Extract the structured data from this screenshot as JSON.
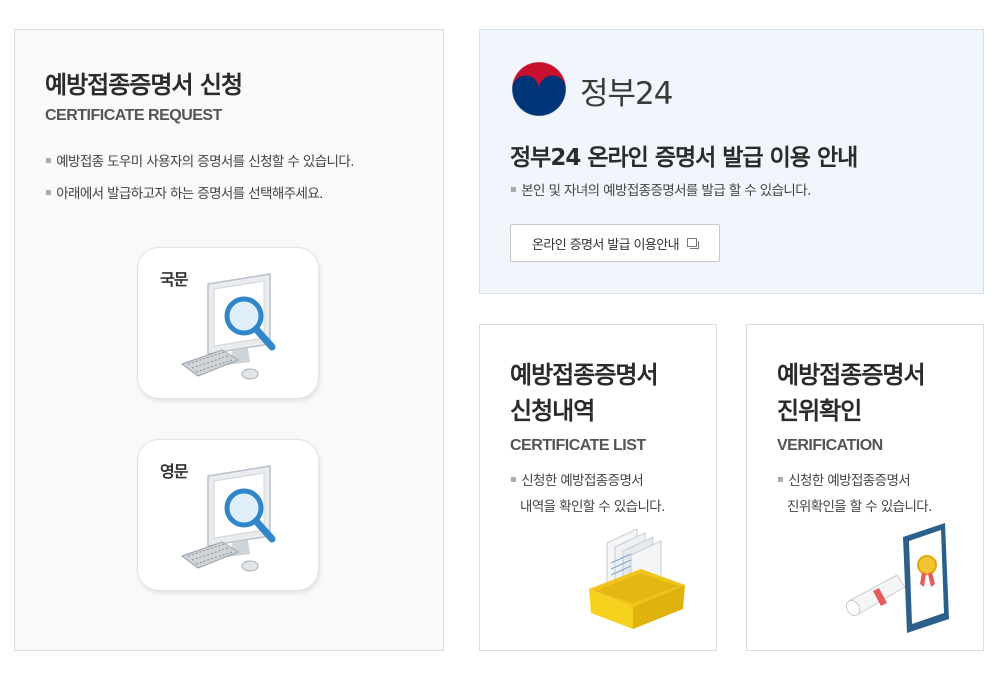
{
  "request": {
    "title": "예방접종증명서 신청",
    "subtitle": "CERTIFICATE REQUEST",
    "bullets": [
      "예방접종 도우미 사용자의 증명서를 신청할 수 있습니다.",
      "아래에서 발급하고자 하는 증명서를 선택해주세요."
    ],
    "options": [
      {
        "label": "국문",
        "icon": "computer-search-icon"
      },
      {
        "label": "영문",
        "icon": "computer-search-icon"
      }
    ]
  },
  "gov24": {
    "logo_text": "정부24",
    "title": "정부24 온라인 증명서 발급 이용 안내",
    "bullet": "본인 및 자녀의 예방접종증명서를 발급 할 수 있습니다.",
    "button_label": "온라인 증명서 발급 이용안내",
    "button_icon": "new-window-icon",
    "colors": {
      "taeguk_red": "#c8102e",
      "taeguk_blue": "#003478",
      "panel_bg": "#f1f6fc"
    }
  },
  "list": {
    "title_line1": "예방접종증명서",
    "title_line2": "신청내역",
    "subtitle": "CERTIFICATE LIST",
    "bullet_line1": "신청한 예방접종증명서",
    "bullet_line2": "내역을 확인할 수 있습니다.",
    "icon": "document-box-icon"
  },
  "verify": {
    "title_line1": "예방접종증명서",
    "title_line2": "진위확인",
    "subtitle": "VERIFICATION",
    "bullet_line1": "신청한 예방접종증명서",
    "bullet_line2": "진위확인을 할 수 있습니다.",
    "icon": "certificate-frame-icon"
  }
}
